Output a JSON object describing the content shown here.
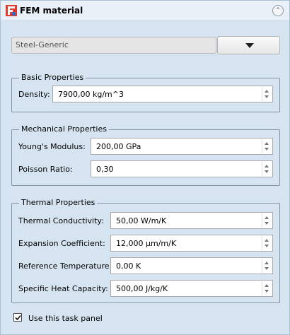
{
  "header": {
    "title": "FEM material"
  },
  "material": {
    "selected": "Steel-Generic"
  },
  "basic": {
    "title": "Basic Properties",
    "fields": [
      {
        "label": "Density:",
        "value": "7900,00 kg/m^3"
      }
    ]
  },
  "mechanical": {
    "title": "Mechanical Properties",
    "fields": [
      {
        "label": "Young's Modulus:",
        "value": "200,00 GPa"
      },
      {
        "label": "Poisson Ratio:",
        "value": "0,30"
      }
    ]
  },
  "thermal": {
    "title": "Thermal Properties",
    "fields": [
      {
        "label": "Thermal Conductivity:",
        "value": "50,00 W/m/K"
      },
      {
        "label": "Expansion Coefficient:",
        "value": "12,000 µm/m/K"
      },
      {
        "label": "Reference Temperature:",
        "value": "0,00 K"
      },
      {
        "label": "Specific Heat Capacity:",
        "value": "500,00 J/kg/K"
      }
    ]
  },
  "footer": {
    "checkbox_label": "Use this task panel",
    "checked": true
  },
  "colors": {
    "panel_bg": "#d6e4f1",
    "logo_red": "#e23a2c",
    "logo_blue": "#2f6fb7"
  }
}
